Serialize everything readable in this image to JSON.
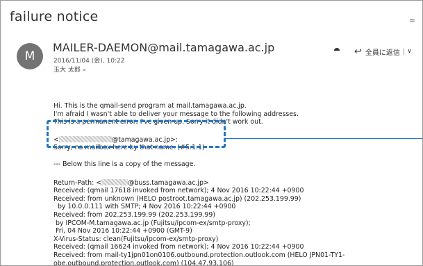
{
  "message": {
    "subject": "failure notice",
    "sender_initial": "M",
    "sender": "MAILER-DAEMON@mail.tamagawa.ac.jp",
    "date": "2016/11/04 (金), 10:22",
    "recipient": "玉大 太郎",
    "recipient_chevron": "»"
  },
  "toolbar": {
    "forward_icon": "⯊",
    "reply_all_icon": "↩",
    "reply_all_label": "全員に返信",
    "separator": "|",
    "more_icon": "∨",
    "collapse_icon": "≈"
  },
  "body": {
    "intro_1": "Hi. This is the qmail-send program at mail.tamagawa.ac.jp.",
    "intro_2": "I'm afraid I wasn't able to deliver your message to the following addresses.",
    "intro_3": "This is a permanent error; I've given up. Sorry it didn't work out.",
    "addr_prefix": "<",
    "addr_suffix": "@tamagawa.ac.jp>:",
    "error_line": "Sorry, no mailbox here by that name. (#5.1.1)",
    "copy_line": "--- Below this line is a copy of the message.",
    "return_prefix": "Return-Path: <",
    "return_suffix": "@buss.tamagawa.ac.jp>",
    "h1": "Received: (qmail 17618 invoked from network); 4 Nov 2016 10:22:44 +0900",
    "h2": "Received: from unknown (HELO postroot.tamagawa.ac.jp) (202.253.199.99)",
    "h3": "  by 10.0.0.111 with SMTP; 4 Nov 2016 10:22:44 +0900",
    "h4": "Received: from 202.253.199.99 (202.253.199.99)",
    "h5": " by IPCOM-M.tamagawa.ac.jp (Fujitsu/ipcom-ex/smtp-proxy);",
    " h6": "",
    "h6": " Fri, 04 Nov 2016 10:22:44 +0900 (GMT-9)",
    "h7": "X-Virus-Status: clean(Fujitsu/ipcom-ex/smtp-proxy)",
    "h8": "Received: (qmail 16624 invoked from network); 4 Nov 2016 10:22:44 +0900",
    "h9": "Received: from mail-ty1jpn01on0106.outbound.protection.outlook.com (HELO JPN01-TY1-",
    "h10": "obe.outbound.protection.outlook.com) (104.47.93.106)"
  },
  "colors": {
    "highlight": "#1f77c9",
    "avatar": "#737373"
  }
}
